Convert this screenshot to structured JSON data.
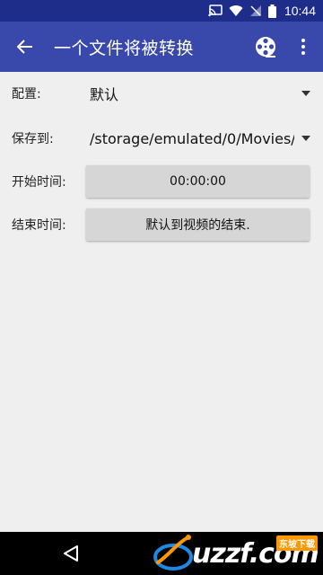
{
  "status_bar": {
    "time": "10:44"
  },
  "app_bar": {
    "title": "一个文件将被转换"
  },
  "form": {
    "config": {
      "label": "配置:",
      "value": "默认"
    },
    "save_to": {
      "label": "保存到:",
      "value": "/storage/emulated/0/Movies/.."
    },
    "start_time": {
      "label": "开始时间:",
      "value": "00:00:00"
    },
    "end_time": {
      "label": "结束时间:",
      "value": "默认到视频的结束."
    }
  },
  "watermark": {
    "text": "uzzf.com",
    "badge": "东坡下载"
  },
  "colors": {
    "app_bar": "#3949ab",
    "status_bar": "#1f2d8a",
    "background": "#efefef",
    "button": "#d6d6d6"
  }
}
